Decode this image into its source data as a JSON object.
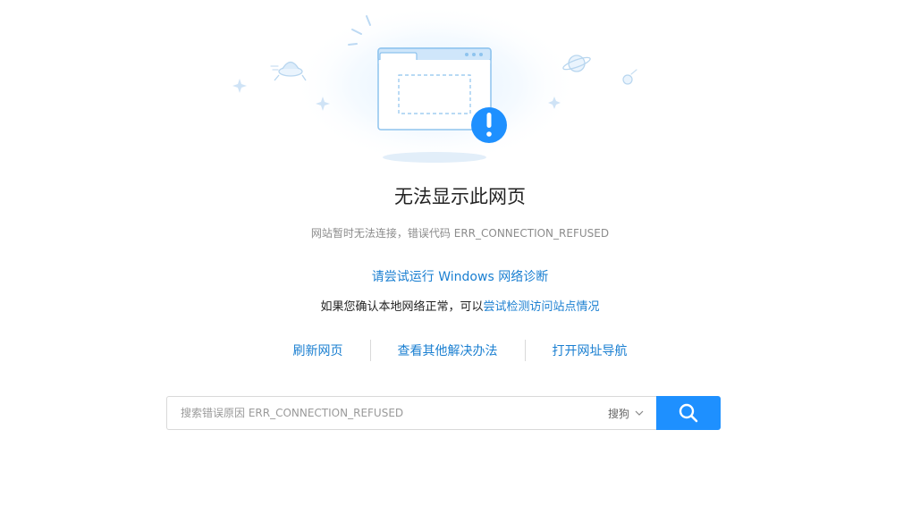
{
  "error": {
    "title": "无法显示此网页",
    "subtitle": "网站暂时无法连接，错误代码 ERR_CONNECTION_REFUSED"
  },
  "help": {
    "diagnose_link": "请尝试运行 Windows 网络诊断",
    "check_prefix": "如果您确认本地网络正常，可以",
    "check_link": "尝试检测访问站点情况"
  },
  "actions": {
    "refresh": "刷新网页",
    "other_solutions": "查看其他解决办法",
    "open_nav": "打开网址导航"
  },
  "search": {
    "placeholder": "搜索错误原因 ERR_CONNECTION_REFUSED",
    "engine": "搜狗"
  },
  "icons": {
    "illustration": "browser-window-error-illustration",
    "dropdown": "chevron-down-icon",
    "search": "search-icon"
  },
  "colors": {
    "link": "#1a7fd1",
    "accent": "#1e90ff",
    "title": "#222222",
    "muted": "#8c8c8c"
  }
}
